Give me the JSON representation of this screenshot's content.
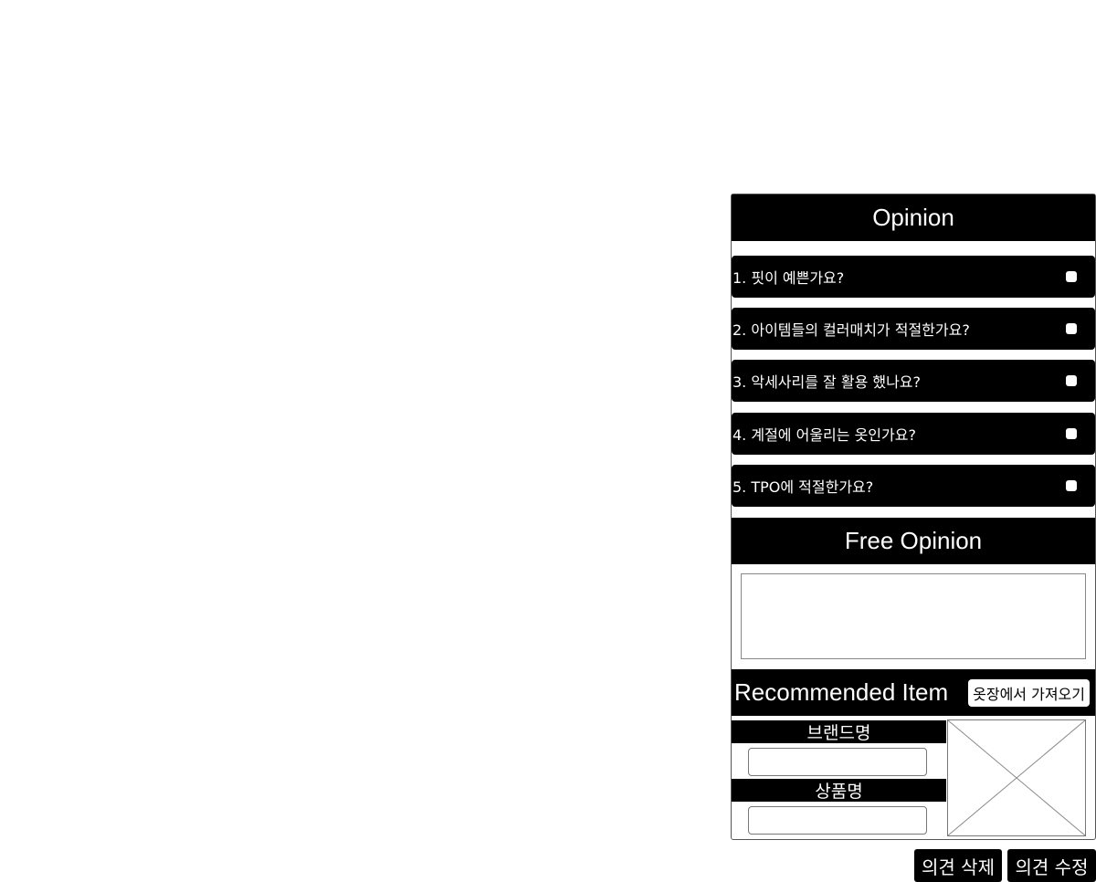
{
  "opinion": {
    "title": "Opinion",
    "questions": [
      {
        "text": "1. 핏이 예쁜가요?"
      },
      {
        "text": "2. 아이템들의 컬러매치가 적절한가요?"
      },
      {
        "text": "3. 악세사리를 잘 활용 했나요?"
      },
      {
        "text": "4. 계절에 어울리는 옷인가요?"
      },
      {
        "text": "5. TPO에 적절한가요?"
      }
    ]
  },
  "free_opinion": {
    "title": "Free Opinion",
    "value": ""
  },
  "recommended": {
    "title": "Recommended Item",
    "closet_button": "옷장에서 가져오기",
    "brand_label": "브랜드명",
    "brand_value": "",
    "product_label": "상품명",
    "product_value": "",
    "image_icon": "image-placeholder-icon"
  },
  "actions": {
    "delete_label": "의견 삭제",
    "edit_label": "의견 수정"
  },
  "colors": {
    "header_bg": "#000000",
    "header_fg": "#ffffff",
    "page_bg": "#ffffff"
  }
}
